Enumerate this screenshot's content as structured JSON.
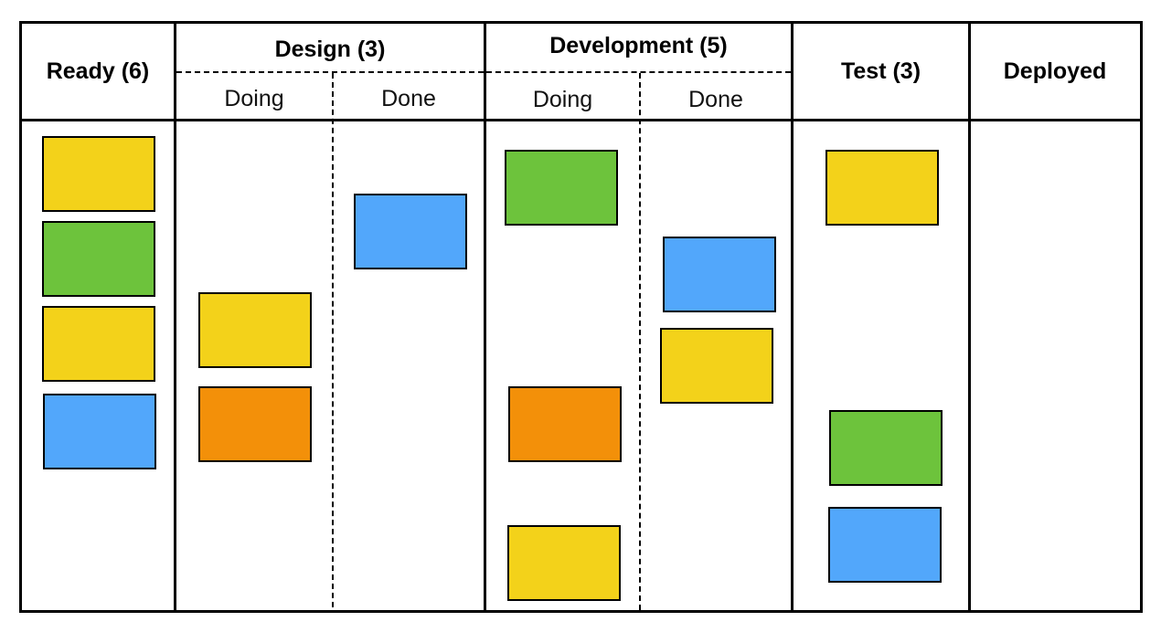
{
  "columns": {
    "ready": {
      "title": "Ready (6)"
    },
    "design": {
      "title": "Design (3)",
      "doing": "Doing",
      "done": "Done"
    },
    "development": {
      "title": "Development (5)",
      "doing": "Doing",
      "done": "Done"
    },
    "test": {
      "title": "Test (3)"
    },
    "deployed": {
      "title": "Deployed"
    }
  },
  "colors": {
    "yellow": "#F3D21A",
    "green": "#6DC33C",
    "blue": "#52A7FB",
    "orange": "#F39009"
  },
  "cards": {
    "ready": [
      "yellow",
      "green",
      "yellow",
      "blue"
    ],
    "design_doing": [
      "yellow",
      "orange"
    ],
    "design_done": [
      "blue"
    ],
    "development_doing": [
      "green",
      "orange",
      "yellow"
    ],
    "development_done": [
      "blue",
      "yellow"
    ],
    "test": [
      "yellow",
      "green",
      "blue"
    ],
    "deployed": []
  }
}
